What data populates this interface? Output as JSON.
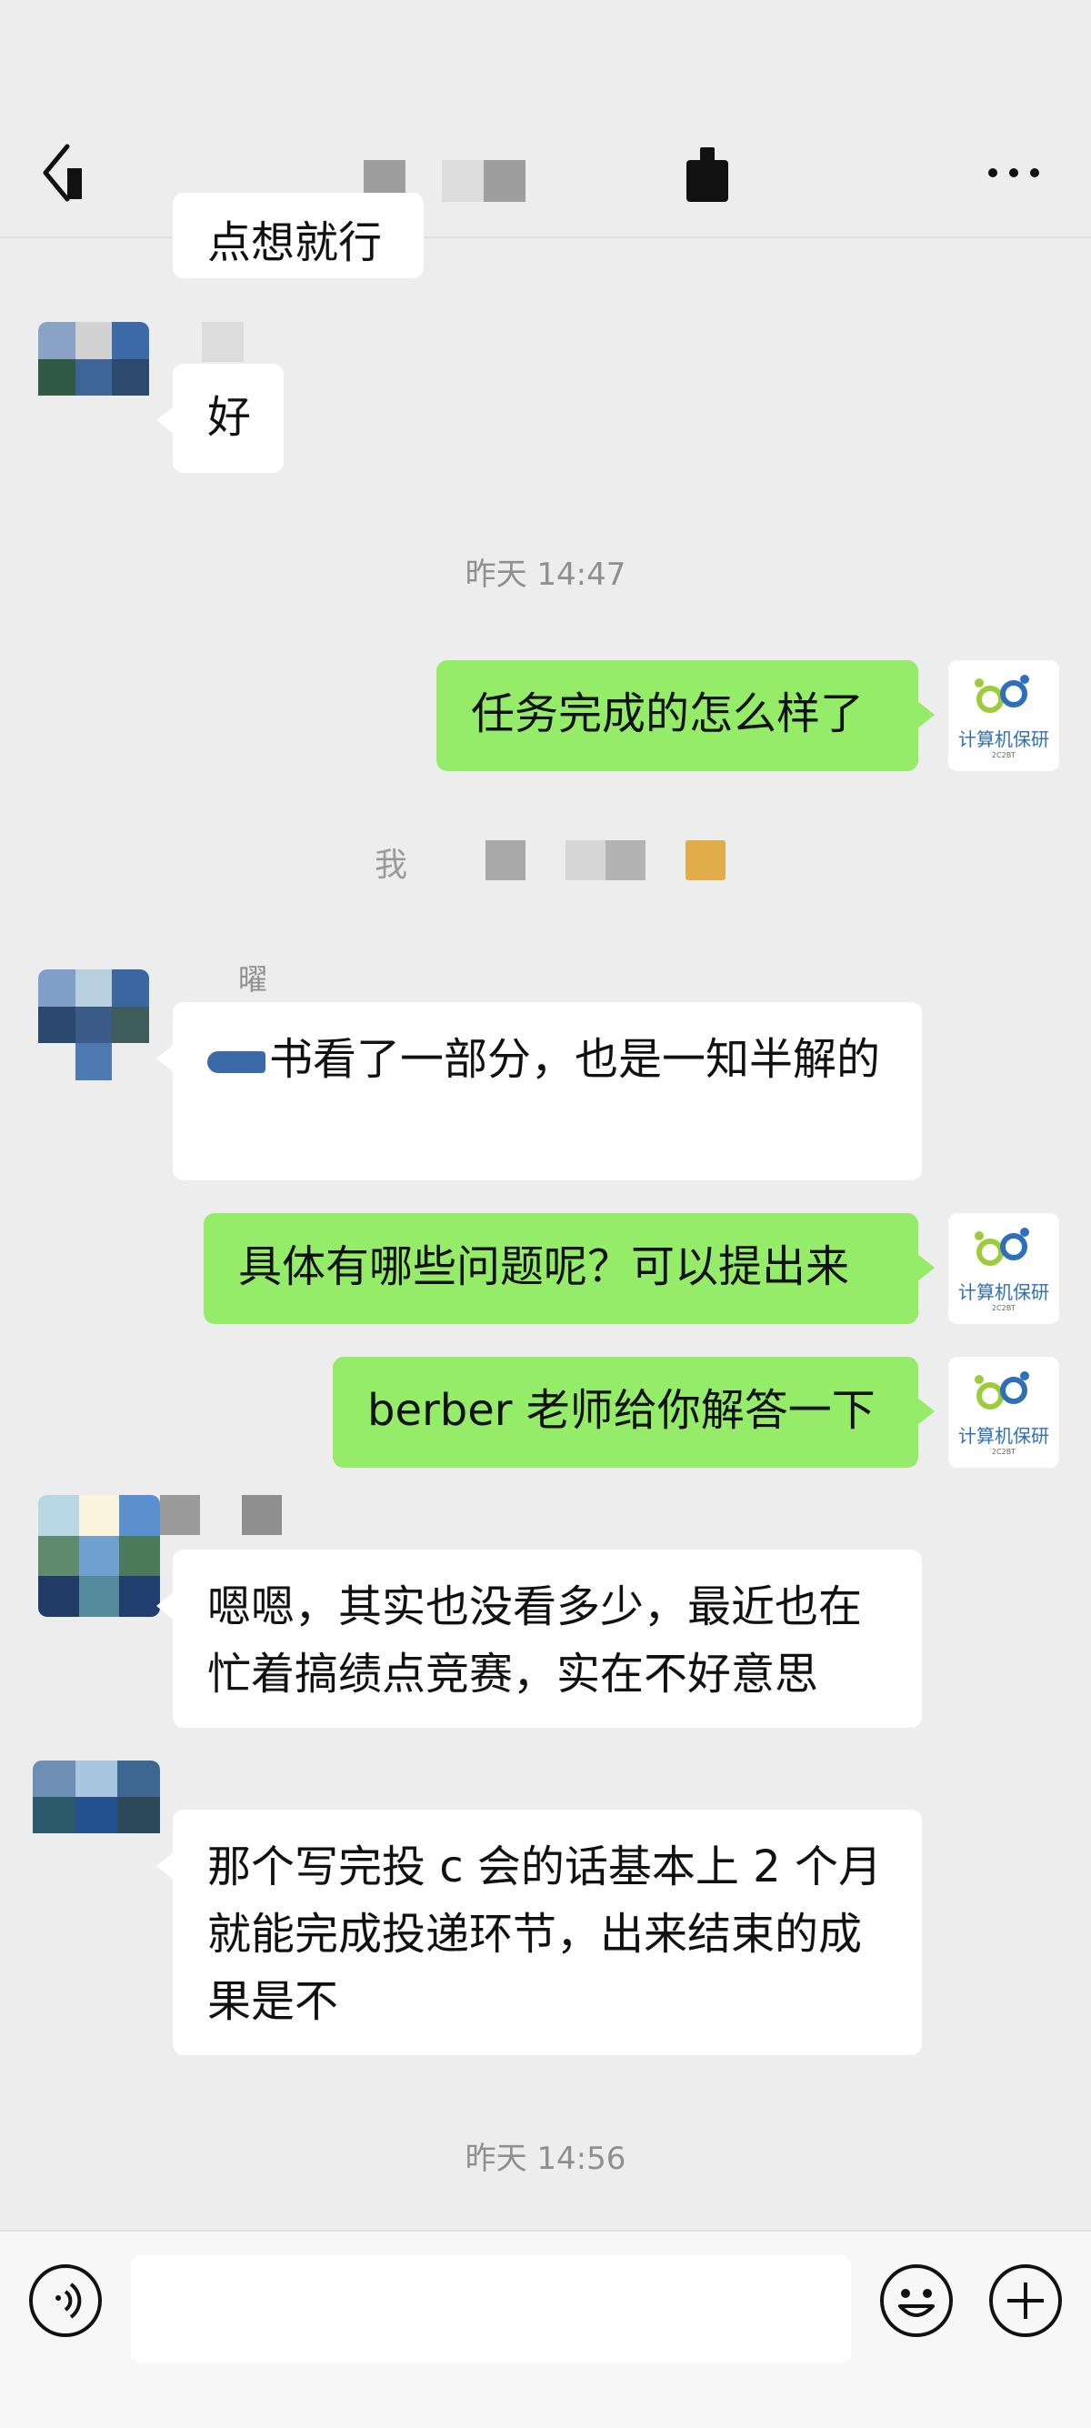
{
  "header": {
    "back_icon": "chevron-left-icon",
    "more_icon": "more-dots-icon"
  },
  "messages": {
    "partial_top_text": "点想就行",
    "msg_good": "好",
    "ts1": "昨天 14:47",
    "msg_task": "任务完成的怎么样了",
    "system_prefix": "我",
    "sender_name_partial": "曜",
    "msg_book": "书看了一部分，也是一知半解的",
    "msg_questions": "具体有哪些问题呢？可以提出来",
    "msg_berber": "berber 老师给你解答一下",
    "msg_busy": "嗯嗯，其实也没看多少，最近也在忙着搞绩点竞赛，实在不好意思",
    "msg_paper": "那个写完投 c 会的话基本上 2 个月就能完成投递环节，出来结束的成果是不",
    "ts2": "昨天 14:56"
  },
  "brand_avatar": {
    "label": "计算机保研",
    "sub": "2C2BT",
    "colors": [
      "#9ccc3c",
      "#2f6fb8"
    ]
  },
  "input_bar": {
    "voice_icon": "voice-icon",
    "emoji_icon": "emoji-icon",
    "plus_icon": "plus-icon"
  }
}
